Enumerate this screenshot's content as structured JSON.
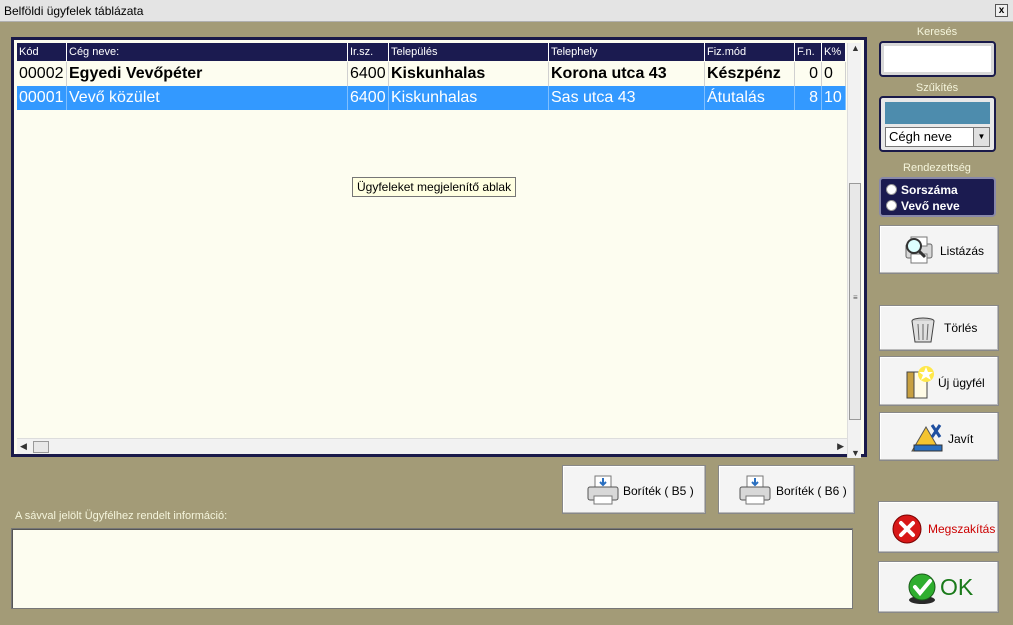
{
  "window": {
    "title": "Belföldi ügyfelek táblázata",
    "close_label": "x"
  },
  "table": {
    "columns": [
      "Kód",
      "Cég neve:",
      "Ir.sz.",
      "Település",
      "Telephely",
      "Fiz.mód",
      "F.n.",
      "K%"
    ],
    "rows": [
      [
        "00002",
        "Egyedi Vevőpéter",
        "6400",
        "Kiskunhalas",
        "Korona utca 43",
        "Készpénz",
        "0",
        "0"
      ],
      [
        "00001",
        "Vevő közület",
        "6400",
        "Kiskunhalas",
        "Sas utca 43",
        "Átutalás",
        "8",
        "10"
      ]
    ],
    "selected_row": 1
  },
  "tooltip": "Ügyfeleket megjelenítő ablak",
  "sidebar": {
    "search_label": "Keresés",
    "search_value": "",
    "filter_label": "Szűkítés",
    "filter_select": "Cégh neve",
    "order_label": "Rendezettség",
    "order_options": [
      "Sorszáma",
      "Vevő neve"
    ],
    "list_button": "Listázás",
    "delete_button": "Törlés",
    "new_button": "Új ügyfél",
    "edit_button": "Javít",
    "cancel_button": "Megszakítás",
    "ok_button": "OK"
  },
  "envelope": {
    "b5_button": "Boríték ( B5 )",
    "b6_button": "Boríték ( B6 )"
  },
  "info": {
    "label": "A sávval jelölt Ügyfélhez rendelt információ:",
    "value": ""
  },
  "colors": {
    "background": "#a39b77",
    "header": "#1b1b50",
    "selection": "#3399ff",
    "cancel_red": "#cc0000",
    "ok_green": "#1a7a1a"
  }
}
